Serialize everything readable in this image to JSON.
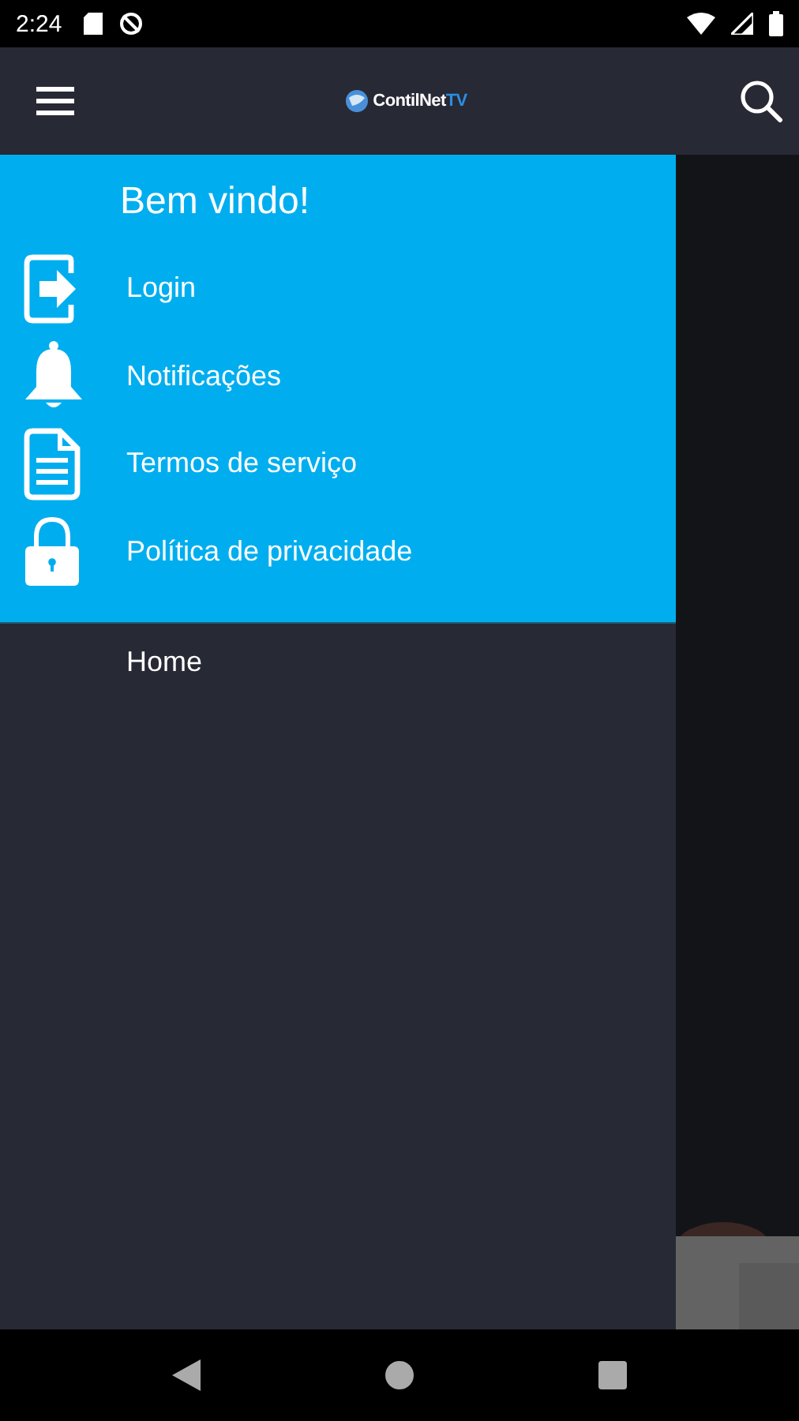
{
  "status_bar": {
    "time": "2:24"
  },
  "app_bar": {
    "logo": {
      "name": "ContilNet",
      "suffix": "TV"
    }
  },
  "drawer": {
    "greeting": "Bem vindo!",
    "header_items": [
      {
        "kind": "login",
        "label": "Login"
      },
      {
        "kind": "bell",
        "label": "Notificações"
      },
      {
        "kind": "document",
        "label": "Termos de serviço"
      },
      {
        "kind": "lock",
        "label": "Política de privacidade"
      }
    ],
    "menu_items": [
      {
        "label": "Home"
      }
    ]
  }
}
